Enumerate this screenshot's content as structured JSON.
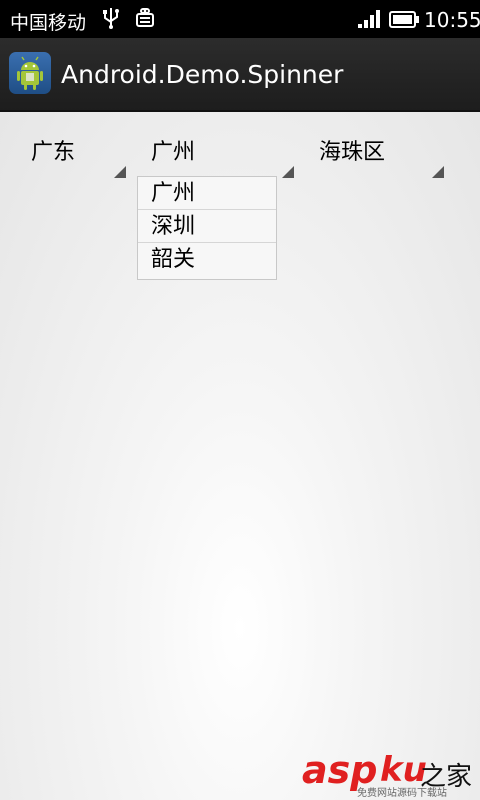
{
  "status_bar": {
    "carrier": "中国移动",
    "time": "10:55",
    "icons": [
      "usb-icon",
      "android-debug-icon",
      "signal-icon",
      "battery-icon"
    ]
  },
  "action_bar": {
    "app_icon": "android-app-icon",
    "title": "Android.Demo.Spinner"
  },
  "spinners": [
    {
      "selected": "广东"
    },
    {
      "selected": "广州"
    },
    {
      "selected": "海珠区"
    }
  ],
  "dropdown": {
    "items": [
      "广州",
      "深圳",
      "韶关"
    ]
  },
  "watermark": {
    "brand": "asp",
    "brand_suffix": "ku",
    "tail": "之家",
    "tagline": "免费网站源码下载站"
  },
  "colors": {
    "statusbar_bg": "#000000",
    "actionbar_bg": "#222222",
    "watermark_red": "#e02020"
  }
}
